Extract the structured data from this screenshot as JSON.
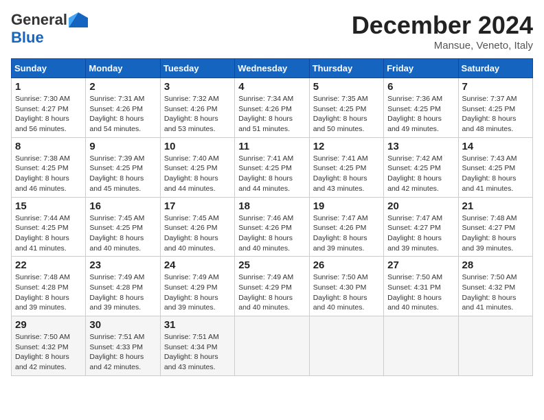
{
  "header": {
    "logo_general": "General",
    "logo_blue": "Blue",
    "month": "December 2024",
    "location": "Mansue, Veneto, Italy"
  },
  "days_of_week": [
    "Sunday",
    "Monday",
    "Tuesday",
    "Wednesday",
    "Thursday",
    "Friday",
    "Saturday"
  ],
  "weeks": [
    [
      {
        "day": "1",
        "sunrise": "Sunrise: 7:30 AM",
        "sunset": "Sunset: 4:27 PM",
        "daylight": "Daylight: 8 hours and 56 minutes."
      },
      {
        "day": "2",
        "sunrise": "Sunrise: 7:31 AM",
        "sunset": "Sunset: 4:26 PM",
        "daylight": "Daylight: 8 hours and 54 minutes."
      },
      {
        "day": "3",
        "sunrise": "Sunrise: 7:32 AM",
        "sunset": "Sunset: 4:26 PM",
        "daylight": "Daylight: 8 hours and 53 minutes."
      },
      {
        "day": "4",
        "sunrise": "Sunrise: 7:34 AM",
        "sunset": "Sunset: 4:26 PM",
        "daylight": "Daylight: 8 hours and 51 minutes."
      },
      {
        "day": "5",
        "sunrise": "Sunrise: 7:35 AM",
        "sunset": "Sunset: 4:25 PM",
        "daylight": "Daylight: 8 hours and 50 minutes."
      },
      {
        "day": "6",
        "sunrise": "Sunrise: 7:36 AM",
        "sunset": "Sunset: 4:25 PM",
        "daylight": "Daylight: 8 hours and 49 minutes."
      },
      {
        "day": "7",
        "sunrise": "Sunrise: 7:37 AM",
        "sunset": "Sunset: 4:25 PM",
        "daylight": "Daylight: 8 hours and 48 minutes."
      }
    ],
    [
      {
        "day": "8",
        "sunrise": "Sunrise: 7:38 AM",
        "sunset": "Sunset: 4:25 PM",
        "daylight": "Daylight: 8 hours and 46 minutes."
      },
      {
        "day": "9",
        "sunrise": "Sunrise: 7:39 AM",
        "sunset": "Sunset: 4:25 PM",
        "daylight": "Daylight: 8 hours and 45 minutes."
      },
      {
        "day": "10",
        "sunrise": "Sunrise: 7:40 AM",
        "sunset": "Sunset: 4:25 PM",
        "daylight": "Daylight: 8 hours and 44 minutes."
      },
      {
        "day": "11",
        "sunrise": "Sunrise: 7:41 AM",
        "sunset": "Sunset: 4:25 PM",
        "daylight": "Daylight: 8 hours and 44 minutes."
      },
      {
        "day": "12",
        "sunrise": "Sunrise: 7:41 AM",
        "sunset": "Sunset: 4:25 PM",
        "daylight": "Daylight: 8 hours and 43 minutes."
      },
      {
        "day": "13",
        "sunrise": "Sunrise: 7:42 AM",
        "sunset": "Sunset: 4:25 PM",
        "daylight": "Daylight: 8 hours and 42 minutes."
      },
      {
        "day": "14",
        "sunrise": "Sunrise: 7:43 AM",
        "sunset": "Sunset: 4:25 PM",
        "daylight": "Daylight: 8 hours and 41 minutes."
      }
    ],
    [
      {
        "day": "15",
        "sunrise": "Sunrise: 7:44 AM",
        "sunset": "Sunset: 4:25 PM",
        "daylight": "Daylight: 8 hours and 41 minutes."
      },
      {
        "day": "16",
        "sunrise": "Sunrise: 7:45 AM",
        "sunset": "Sunset: 4:25 PM",
        "daylight": "Daylight: 8 hours and 40 minutes."
      },
      {
        "day": "17",
        "sunrise": "Sunrise: 7:45 AM",
        "sunset": "Sunset: 4:26 PM",
        "daylight": "Daylight: 8 hours and 40 minutes."
      },
      {
        "day": "18",
        "sunrise": "Sunrise: 7:46 AM",
        "sunset": "Sunset: 4:26 PM",
        "daylight": "Daylight: 8 hours and 40 minutes."
      },
      {
        "day": "19",
        "sunrise": "Sunrise: 7:47 AM",
        "sunset": "Sunset: 4:26 PM",
        "daylight": "Daylight: 8 hours and 39 minutes."
      },
      {
        "day": "20",
        "sunrise": "Sunrise: 7:47 AM",
        "sunset": "Sunset: 4:27 PM",
        "daylight": "Daylight: 8 hours and 39 minutes."
      },
      {
        "day": "21",
        "sunrise": "Sunrise: 7:48 AM",
        "sunset": "Sunset: 4:27 PM",
        "daylight": "Daylight: 8 hours and 39 minutes."
      }
    ],
    [
      {
        "day": "22",
        "sunrise": "Sunrise: 7:48 AM",
        "sunset": "Sunset: 4:28 PM",
        "daylight": "Daylight: 8 hours and 39 minutes."
      },
      {
        "day": "23",
        "sunrise": "Sunrise: 7:49 AM",
        "sunset": "Sunset: 4:28 PM",
        "daylight": "Daylight: 8 hours and 39 minutes."
      },
      {
        "day": "24",
        "sunrise": "Sunrise: 7:49 AM",
        "sunset": "Sunset: 4:29 PM",
        "daylight": "Daylight: 8 hours and 39 minutes."
      },
      {
        "day": "25",
        "sunrise": "Sunrise: 7:49 AM",
        "sunset": "Sunset: 4:29 PM",
        "daylight": "Daylight: 8 hours and 40 minutes."
      },
      {
        "day": "26",
        "sunrise": "Sunrise: 7:50 AM",
        "sunset": "Sunset: 4:30 PM",
        "daylight": "Daylight: 8 hours and 40 minutes."
      },
      {
        "day": "27",
        "sunrise": "Sunrise: 7:50 AM",
        "sunset": "Sunset: 4:31 PM",
        "daylight": "Daylight: 8 hours and 40 minutes."
      },
      {
        "day": "28",
        "sunrise": "Sunrise: 7:50 AM",
        "sunset": "Sunset: 4:32 PM",
        "daylight": "Daylight: 8 hours and 41 minutes."
      }
    ],
    [
      {
        "day": "29",
        "sunrise": "Sunrise: 7:50 AM",
        "sunset": "Sunset: 4:32 PM",
        "daylight": "Daylight: 8 hours and 42 minutes."
      },
      {
        "day": "30",
        "sunrise": "Sunrise: 7:51 AM",
        "sunset": "Sunset: 4:33 PM",
        "daylight": "Daylight: 8 hours and 42 minutes."
      },
      {
        "day": "31",
        "sunrise": "Sunrise: 7:51 AM",
        "sunset": "Sunset: 4:34 PM",
        "daylight": "Daylight: 8 hours and 43 minutes."
      },
      null,
      null,
      null,
      null
    ]
  ]
}
